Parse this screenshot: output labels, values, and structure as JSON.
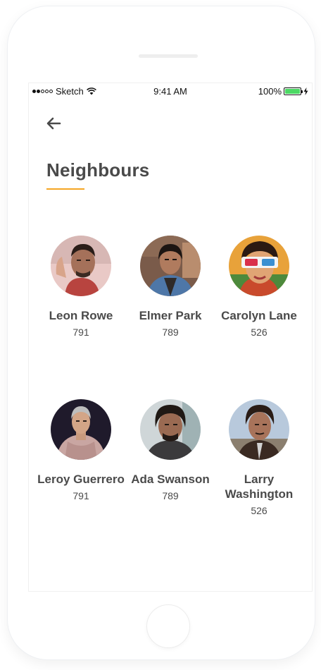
{
  "status_bar": {
    "carrier": "Sketch",
    "time": "9:41 AM",
    "battery": "100%"
  },
  "header": {
    "back_icon": "arrow-left-icon",
    "title": "Neighbours",
    "accent_color": "#f5a623"
  },
  "neighbours": [
    {
      "name": "Leon Rowe",
      "count": "791"
    },
    {
      "name": "Elmer Park",
      "count": "789"
    },
    {
      "name": "Carolyn Lane",
      "count": "526"
    },
    {
      "name": "Leroy Guerrero",
      "count": "791"
    },
    {
      "name": "Ada Swanson",
      "count": "789"
    },
    {
      "name": "Larry Washington",
      "count": "526"
    }
  ]
}
